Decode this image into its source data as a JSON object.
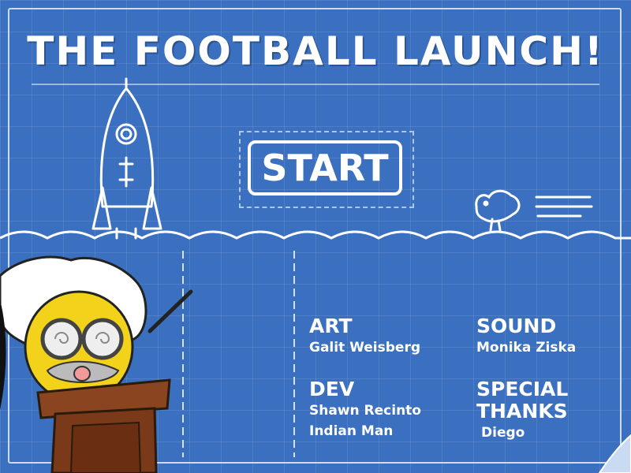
{
  "title": "THE FOOTBALL LAUNCH!",
  "start_label": "START",
  "credits": {
    "art": {
      "heading": "ART",
      "names": [
        "Galit Weisberg"
      ]
    },
    "sound": {
      "heading": "SOUND",
      "names": [
        "Monika Ziska"
      ]
    },
    "dev": {
      "heading": "DEV",
      "names": [
        "Shawn Recinto",
        "Indian Man"
      ]
    },
    "special": {
      "heading_1": "SPECIAL",
      "heading_2": "THANKS",
      "names": [
        "Diego"
      ]
    }
  },
  "icons": [
    "rocket-icon",
    "bird-icon",
    "professor-icon",
    "podium-icon",
    "page-curl-icon"
  ],
  "colors": {
    "background": "#3a70bf",
    "lines": "#ffffff",
    "podium": "#7a3a1a",
    "professor-face": "#f2d21a"
  }
}
